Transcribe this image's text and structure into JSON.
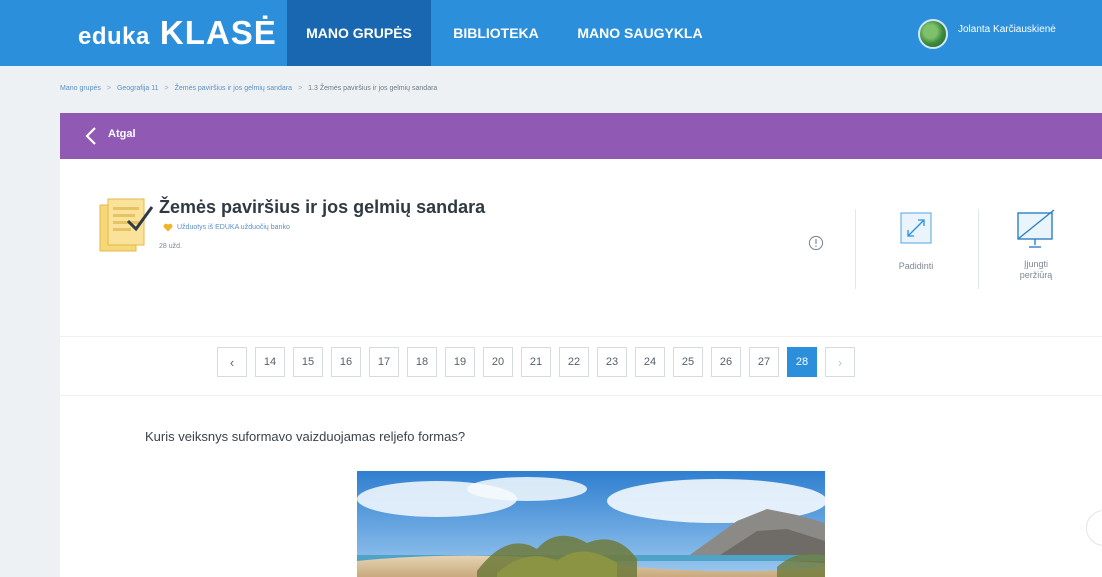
{
  "header": {
    "logo_left": "eduka",
    "logo_right": "KLASĖ",
    "nav": [
      "MANO GRUPĖS",
      "BIBLIOTEKA",
      "MANO SAUGYKLA"
    ],
    "user_name": "Jolanta Karčiauskienė"
  },
  "breadcrumb": [
    "Mano grupės",
    "Geografija 11",
    "Žemės paviršius ir jos gelmių sandara",
    "1.3 Žemės paviršius ir jos gelmių sandara"
  ],
  "backbar": {
    "label": "Atgal"
  },
  "task": {
    "title": "Žemės paviršius ir jos gelmių sandara",
    "source": "Užduotys iš EDUKA užduočių banko",
    "count": "28 užd."
  },
  "actions": {
    "expand": "Padidinti",
    "preview": [
      "Įjungti",
      "peržiūrą"
    ]
  },
  "pagination": {
    "prev": "‹",
    "next": "›",
    "pages": [
      "14",
      "15",
      "16",
      "17",
      "18",
      "19",
      "20",
      "21",
      "22",
      "23",
      "24",
      "25",
      "26",
      "27",
      "28"
    ],
    "current": "28"
  },
  "question": {
    "text": "Kuris veiksnys suformavo vaizduojamas reljefo formas?"
  },
  "colors": {
    "topbar": "#2b8fdc",
    "nav_active": "#1967b0",
    "backbar": "#9059b4",
    "page_active": "#2b8fdc"
  }
}
